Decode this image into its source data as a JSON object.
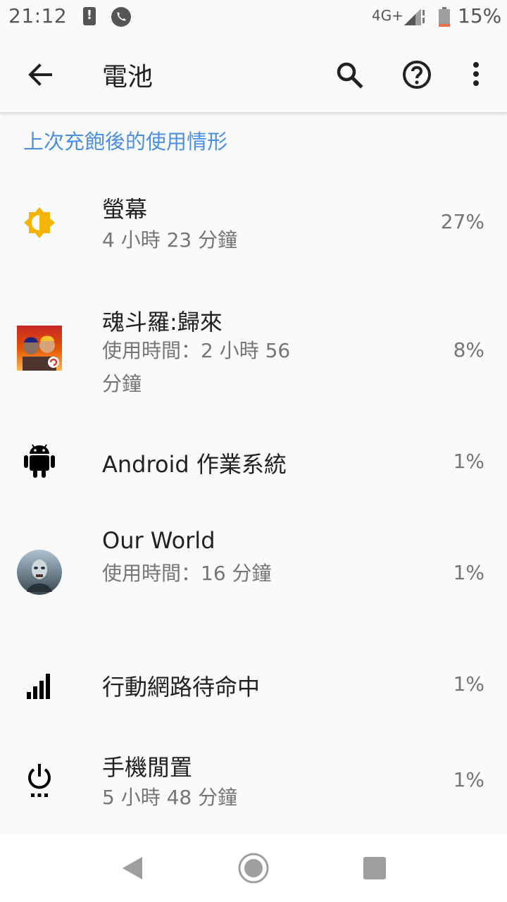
{
  "status_bar": {
    "time": "21:12",
    "network": "4G+",
    "battery_pct": "15%",
    "battery_level": 0.15
  },
  "app_bar": {
    "title": "電池",
    "icons": [
      "back-arrow-icon",
      "search-icon",
      "help-icon",
      "more-vert-icon"
    ]
  },
  "section": {
    "header": "上次充飽後的使用情形"
  },
  "items": [
    {
      "title": "螢幕",
      "subtitle": "4 小時 23 分鐘",
      "percent": "27%",
      "icon": "brightness-icon"
    },
    {
      "title": "魂斗羅:歸來",
      "subtitle": "使用時間：2 小時 56 分鐘",
      "percent": "8%",
      "icon": "contra-app-icon"
    },
    {
      "title": "Android 作業系統",
      "subtitle": "",
      "percent": "1%",
      "icon": "android-icon"
    },
    {
      "title": "Our World",
      "subtitle": "使用時間：16 分鐘",
      "percent": "1%",
      "icon": "our-world-app-icon"
    },
    {
      "title": "行動網路待命中",
      "subtitle": "",
      "percent": "1%",
      "icon": "cell-signal-icon"
    },
    {
      "title": "手機閒置",
      "subtitle": "5 小時 48 分鐘",
      "percent": "1%",
      "icon": "power-idle-icon"
    }
  ],
  "colors": {
    "accent": "#4a90e2",
    "brightness": "#f4b400",
    "battery_low": "#e8704d"
  }
}
